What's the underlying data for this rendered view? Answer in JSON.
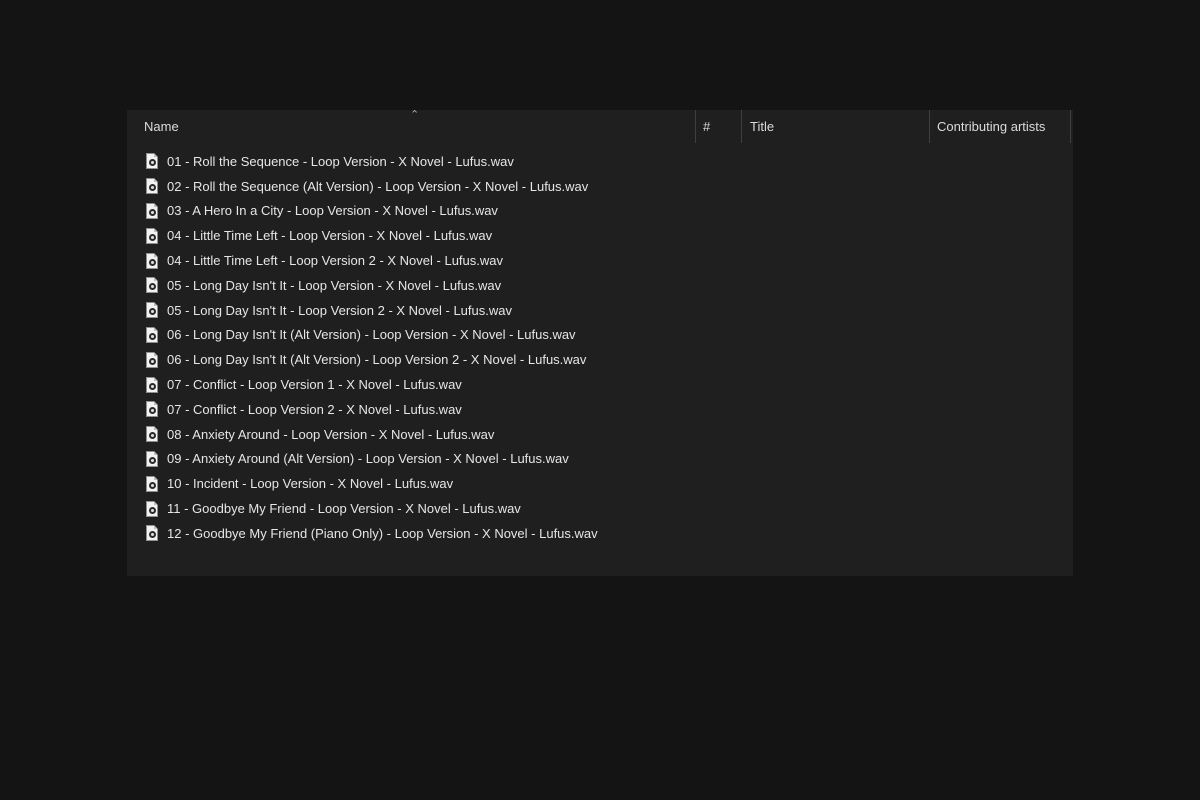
{
  "columns": {
    "name": "Name",
    "number": "#",
    "title": "Title",
    "contributing_artists": "Contributing artists"
  },
  "sort": {
    "column": "name",
    "direction": "ascending",
    "indicator_icon": "chevron-up-icon"
  },
  "colors": {
    "background": "#141414",
    "panel": "#1f1f20",
    "text": "#e6e6e6",
    "header_text": "#dcdcdc",
    "divider": "#3f3f40"
  },
  "files": [
    {
      "icon": "audio-file-icon",
      "name": "01 - Roll the Sequence - Loop Version - X Novel - Lufus.wav"
    },
    {
      "icon": "audio-file-icon",
      "name": "02 - Roll the Sequence (Alt Version) - Loop Version - X Novel - Lufus.wav"
    },
    {
      "icon": "audio-file-icon",
      "name": "03 - A Hero In a City - Loop Version - X Novel - Lufus.wav"
    },
    {
      "icon": "audio-file-icon",
      "name": "04 - Little Time Left - Loop Version - X Novel - Lufus.wav"
    },
    {
      "icon": "audio-file-icon",
      "name": "04 - Little Time Left - Loop Version 2 - X Novel - Lufus.wav"
    },
    {
      "icon": "audio-file-icon",
      "name": "05 - Long Day Isn't It - Loop Version - X Novel - Lufus.wav"
    },
    {
      "icon": "audio-file-icon",
      "name": "05 - Long Day Isn't It - Loop Version 2 - X Novel - Lufus.wav"
    },
    {
      "icon": "audio-file-icon",
      "name": "06 - Long Day Isn't It (Alt Version) - Loop Version - X Novel - Lufus.wav"
    },
    {
      "icon": "audio-file-icon",
      "name": "06 - Long Day Isn't It (Alt Version) - Loop Version 2 - X Novel - Lufus.wav"
    },
    {
      "icon": "audio-file-icon",
      "name": "07 - Conflict - Loop Version 1 - X Novel - Lufus.wav"
    },
    {
      "icon": "audio-file-icon",
      "name": "07 - Conflict - Loop Version 2 - X Novel - Lufus.wav"
    },
    {
      "icon": "audio-file-icon",
      "name": "08 - Anxiety Around - Loop Version - X Novel - Lufus.wav"
    },
    {
      "icon": "audio-file-icon",
      "name": "09 - Anxiety Around (Alt Version) - Loop Version - X Novel - Lufus.wav"
    },
    {
      "icon": "audio-file-icon",
      "name": "10 - Incident - Loop Version - X Novel - Lufus.wav"
    },
    {
      "icon": "audio-file-icon",
      "name": "11 - Goodbye My Friend - Loop Version - X Novel - Lufus.wav"
    },
    {
      "icon": "audio-file-icon",
      "name": "12 - Goodbye My Friend (Piano Only) - Loop Version - X Novel - Lufus.wav"
    }
  ]
}
